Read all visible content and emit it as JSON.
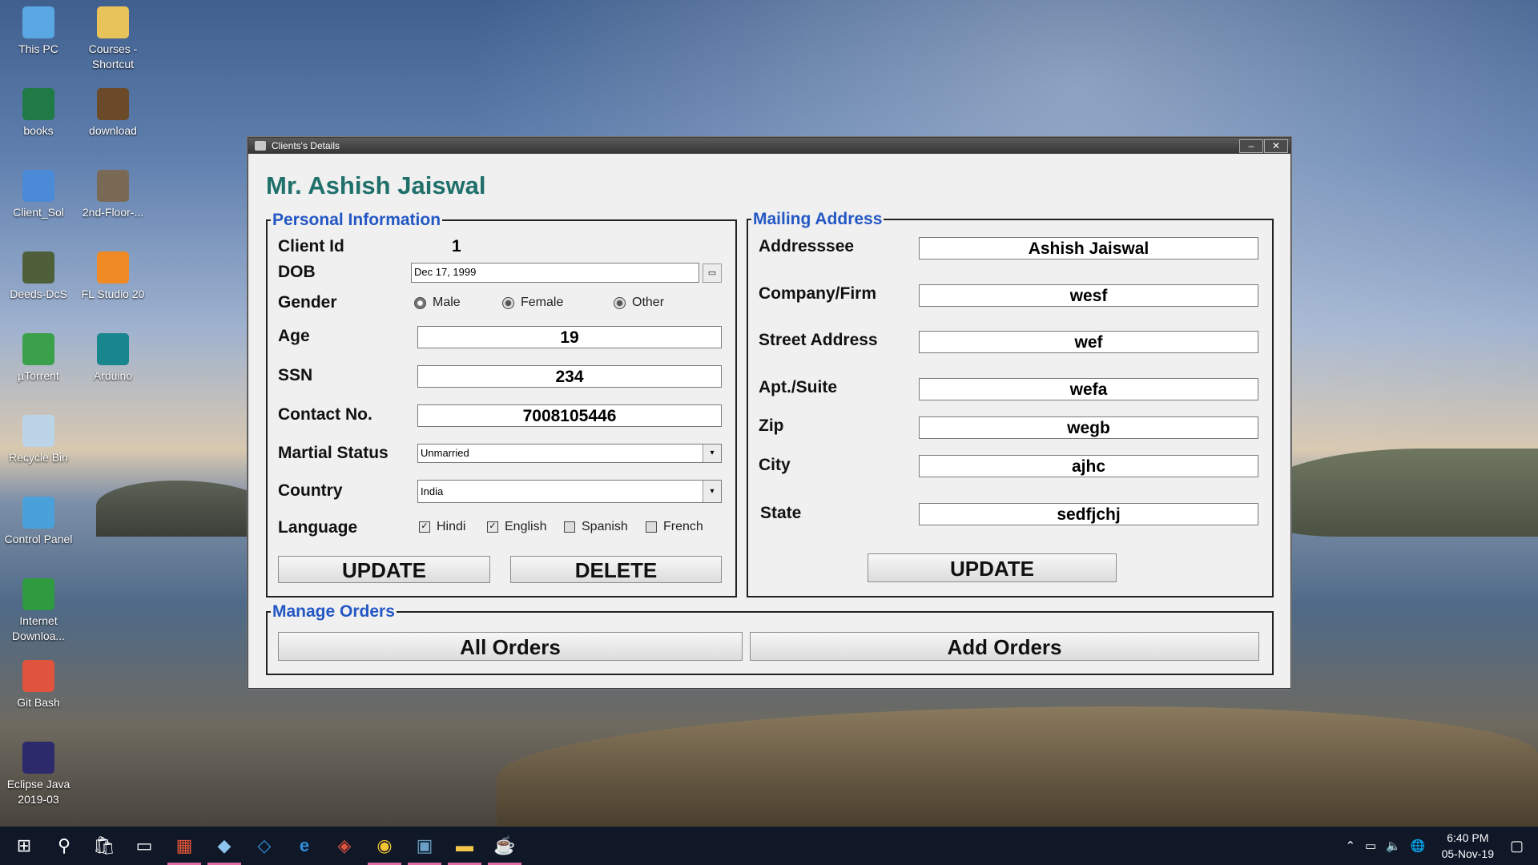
{
  "desktop": {
    "icons": [
      {
        "label": "This PC",
        "icon": "computer-icon",
        "color": "#5aa7e6"
      },
      {
        "label": "Courses - Shortcut",
        "icon": "folder-shortcut-icon",
        "color": "#e8c35a"
      },
      {
        "label": "books",
        "icon": "excel-file-icon",
        "color": "#1f7a45"
      },
      {
        "label": "download",
        "icon": "image-file-icon",
        "color": "#6b4a2a"
      },
      {
        "label": "Client_Sol",
        "icon": "app-shortcut-icon",
        "color": "#4a8ad6"
      },
      {
        "label": "2nd-Floor-...",
        "icon": "image-file-icon",
        "color": "#7a6a55"
      },
      {
        "label": "Deeds-DcS",
        "icon": "circuit-app-icon",
        "color": "#4f5f3a"
      },
      {
        "label": "FL Studio 20",
        "icon": "fl-studio-icon",
        "color": "#f08a24"
      },
      {
        "label": "µTorrent",
        "icon": "utorrent-icon",
        "color": "#3aa14a"
      },
      {
        "label": "Arduino",
        "icon": "arduino-icon",
        "color": "#19858c"
      },
      {
        "label": "Recycle Bin",
        "icon": "recycle-bin-icon",
        "color": "#bcd4e8"
      },
      {
        "label": "Control Panel",
        "icon": "control-panel-icon",
        "color": "#4aa0d8"
      },
      {
        "label": "Internet Downloa...",
        "icon": "internet-download-icon",
        "color": "#2f9a3f"
      },
      {
        "label": "Git Bash",
        "icon": "git-icon",
        "color": "#e0533d"
      },
      {
        "label": "Eclipse Java 2019-03",
        "icon": "eclipse-icon",
        "color": "#2c2a6b"
      }
    ]
  },
  "window": {
    "title": "Clients's Details",
    "minimize_glyph": "–",
    "close_glyph": "✕",
    "client_name": "Mr. Ashish Jaiswal",
    "personal": {
      "legend": "Personal Information",
      "client_id_label": "Client Id",
      "client_id_value": "1",
      "dob_label": "DOB",
      "dob_value": "Dec 17, 1999",
      "calendar_glyph": "▭",
      "gender_label": "Gender",
      "gender_options": [
        "Male",
        "Female",
        "Other"
      ],
      "gender_selected": "Male",
      "age_label": "Age",
      "age_value": "19",
      "ssn_label": "SSN",
      "ssn_value": "234",
      "contact_label": "Contact No.",
      "contact_value": "7008105446",
      "marital_label": "Martial Status",
      "marital_value": "Unmarried",
      "country_label": "Country",
      "country_value": "India",
      "dropdown_glyph": "▾",
      "language_label": "Language",
      "languages": [
        {
          "name": "Hindi",
          "checked": true
        },
        {
          "name": "English",
          "checked": true
        },
        {
          "name": "Spanish",
          "checked": false
        },
        {
          "name": "French",
          "checked": false
        }
      ],
      "check_glyph": "✓",
      "update_label": "UPDATE",
      "delete_label": "DELETE"
    },
    "mailing": {
      "legend": "Mailing Address",
      "addressee_label": "Addresssee",
      "addressee_value": "Ashish Jaiswal",
      "company_label": "Company/Firm",
      "company_value": "wesf",
      "street_label": "Street Address",
      "street_value": "wef",
      "apt_label": "Apt./Suite",
      "apt_value": "wefa",
      "zip_label": "Zip",
      "zip_value": "wegb",
      "city_label": "City",
      "city_value": "ajhc",
      "state_label": "State",
      "state_value": "sedfjchj",
      "update_label": "UPDATE"
    },
    "orders": {
      "legend": "Manage Orders",
      "all_orders_label": "All Orders",
      "add_orders_label": "Add Orders"
    }
  },
  "taskbar": {
    "items": [
      {
        "icon": "windows-start-icon",
        "glyph": "⊞",
        "active": false
      },
      {
        "icon": "search-icon",
        "glyph": "⚲",
        "active": false
      },
      {
        "icon": "store-icon",
        "glyph": "🛍",
        "active": false
      },
      {
        "icon": "terminal-icon",
        "glyph": "▭",
        "active": false
      },
      {
        "icon": "app-grid-icon",
        "glyph": "▦",
        "active": true
      },
      {
        "icon": "cube-app-icon",
        "glyph": "◆",
        "active": true
      },
      {
        "icon": "vscode-icon",
        "glyph": "◇",
        "active": false
      },
      {
        "icon": "edge-icon",
        "glyph": "e",
        "active": false
      },
      {
        "icon": "git-icon",
        "glyph": "◈",
        "active": false
      },
      {
        "icon": "chrome-icon",
        "glyph": "◉",
        "active": true
      },
      {
        "icon": "mysql-icon",
        "glyph": "▣",
        "active": true
      },
      {
        "icon": "file-explorer-icon",
        "glyph": "▬",
        "active": true
      },
      {
        "icon": "java-icon",
        "glyph": "☕",
        "active": true
      }
    ],
    "tray_glyphs": [
      "⌃",
      "▭",
      "🔈",
      "🌐"
    ],
    "time": "6:40 PM",
    "date": "05-Nov-19",
    "notification_glyph": "▢"
  }
}
